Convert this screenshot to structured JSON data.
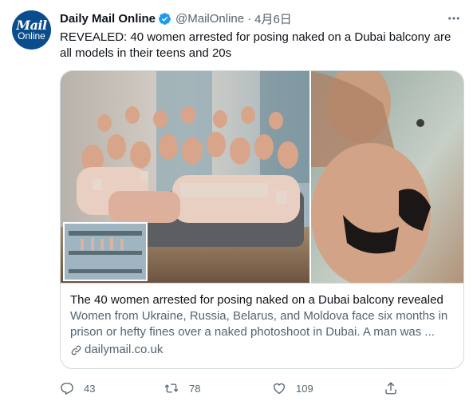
{
  "tweet": {
    "avatar": {
      "line1": "Mail",
      "line2": "Online",
      "bg_color": "#0a4d8c"
    },
    "author_name": "Daily Mail Online",
    "handle": "@MailOnline",
    "separator": "·",
    "date": "4月6日",
    "verified_color": "#1d9bf0",
    "more_icon": "more-icon",
    "text": "REVEALED: 40 women arrested for posing naked on a Dubai balcony are all models in their teens and 20s"
  },
  "card": {
    "title": "The 40 women arrested for posing naked on a Dubai balcony revealed",
    "description": "Women from Ukraine, Russia, Belarus, and Moldova face six months in prison or hefty fines over a naked photoshoot in Dubai. A man was ...",
    "domain": "dailymail.co.uk",
    "link_icon": "link-icon"
  },
  "actions": {
    "reply_count": "43",
    "retweet_count": "78",
    "like_count": "109",
    "icons": [
      "reply-icon",
      "retweet-icon",
      "like-icon",
      "share-icon"
    ]
  }
}
